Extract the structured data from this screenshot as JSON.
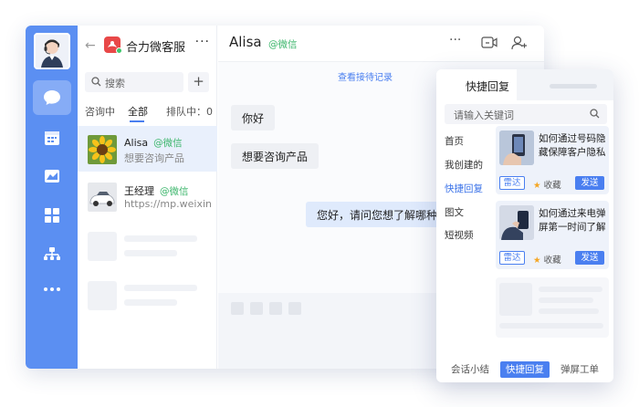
{
  "colors": {
    "rail": "#5b8ff2",
    "accent": "#4a7ff0",
    "wechat_green": "#3ab56a",
    "brand_red": "#e84848"
  },
  "header": {
    "back_icon": "arrow-left-icon",
    "app_name": "合力微客服",
    "more": "···"
  },
  "sidebar": {
    "icons": [
      "chat-bubble-icon",
      "calendar-icon",
      "chart-icon",
      "grid-icon",
      "org-tree-icon",
      "more-icon"
    ],
    "active_index": 0
  },
  "list": {
    "search_placeholder": "搜索",
    "add_label": "+",
    "tabs": [
      {
        "label": "咨询中"
      },
      {
        "label": "全部",
        "active": true
      },
      {
        "label": "排队中：0"
      }
    ],
    "conversations": [
      {
        "name": "Alisa",
        "source": "@微信",
        "preview": "想要咨询产品",
        "active": true
      },
      {
        "name": "王经理",
        "source": "@微信",
        "preview": "https://mp.weixin.qq.com"
      }
    ]
  },
  "chat": {
    "contact_name": "Alisa",
    "contact_source": "@微信",
    "more": "···",
    "history_link": "查看接待记录",
    "messages": [
      {
        "direction": "in",
        "text": "你好"
      },
      {
        "direction": "in",
        "text": "想要咨询产品"
      },
      {
        "direction": "out",
        "text": "您好，请问您想了解哪种产品"
      }
    ]
  },
  "quick_reply": {
    "title": "快捷回复",
    "search_placeholder": "请输入关键词",
    "categories": [
      {
        "label": "首页"
      },
      {
        "label": "我创建的"
      },
      {
        "label": "快捷回复",
        "active": true
      },
      {
        "label": "图文"
      },
      {
        "label": "短视频"
      }
    ],
    "cards": [
      {
        "title": "如何通过号码隐藏保障客户隐私",
        "radar": "雷达",
        "fav": "收藏",
        "send": "发送"
      },
      {
        "title": "如何通过来电弹屏第一时间了解客户",
        "radar": "雷达",
        "fav": "收藏",
        "send": "发送"
      }
    ],
    "footer": [
      {
        "label": "会话小结"
      },
      {
        "label": "快捷回复",
        "active": true
      },
      {
        "label": "弹屏工单"
      }
    ]
  }
}
